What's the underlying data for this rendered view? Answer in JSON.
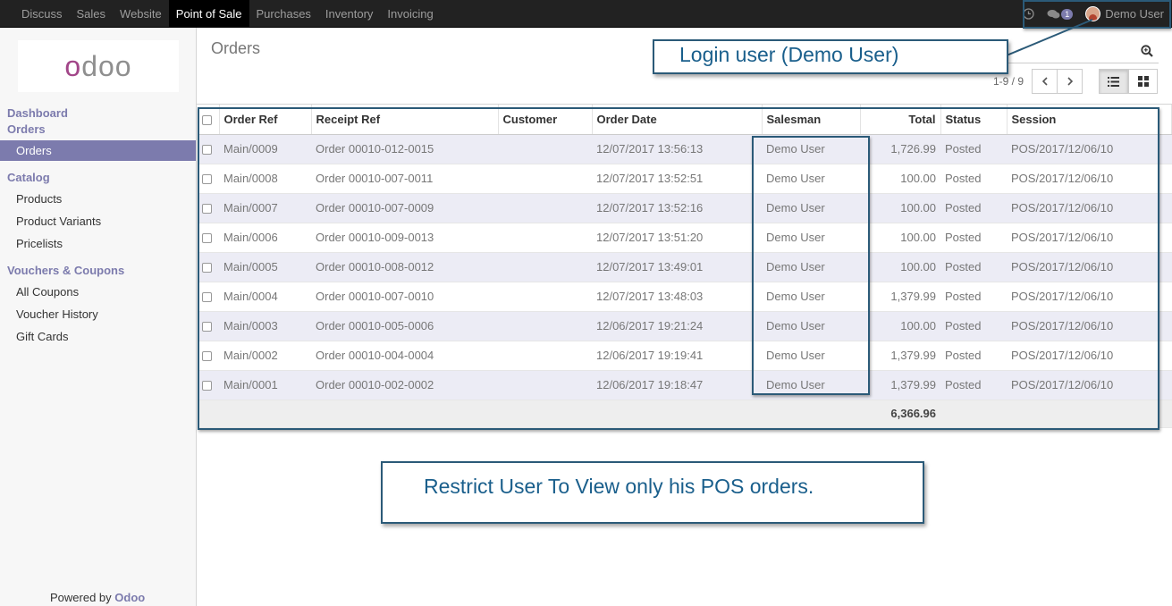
{
  "topbar": {
    "menu": [
      "Discuss",
      "Sales",
      "Website",
      "Point of Sale",
      "Purchases",
      "Inventory",
      "Invoicing"
    ],
    "active": "Point of Sale",
    "messages_badge": "1",
    "user": "Demo User"
  },
  "sidebar": {
    "logo": "odoo",
    "dashboard": "Dashboard",
    "orders_head": "Orders",
    "orders_item": "Orders",
    "catalog": "Catalog",
    "catalog_items": [
      "Products",
      "Product Variants",
      "Pricelists"
    ],
    "vouchers": "Vouchers & Coupons",
    "voucher_items": [
      "All Coupons",
      "Voucher History",
      "Gift Cards"
    ],
    "powered_prefix": "Powered by",
    "powered_brand": "Odoo"
  },
  "control": {
    "title": "Orders",
    "pager": "1-9 / 9"
  },
  "table": {
    "columns": [
      "Order Ref",
      "Receipt Ref",
      "Customer",
      "Order Date",
      "Salesman",
      "Total",
      "Status",
      "Session"
    ],
    "rows": [
      [
        "Main/0009",
        "Order 00010-012-0015",
        "",
        "12/07/2017 13:56:13",
        "Demo User",
        "1,726.99",
        "Posted",
        "POS/2017/12/06/10"
      ],
      [
        "Main/0008",
        "Order 00010-007-0011",
        "",
        "12/07/2017 13:52:51",
        "Demo User",
        "100.00",
        "Posted",
        "POS/2017/12/06/10"
      ],
      [
        "Main/0007",
        "Order 00010-007-0009",
        "",
        "12/07/2017 13:52:16",
        "Demo User",
        "100.00",
        "Posted",
        "POS/2017/12/06/10"
      ],
      [
        "Main/0006",
        "Order 00010-009-0013",
        "",
        "12/07/2017 13:51:20",
        "Demo User",
        "100.00",
        "Posted",
        "POS/2017/12/06/10"
      ],
      [
        "Main/0005",
        "Order 00010-008-0012",
        "",
        "12/07/2017 13:49:01",
        "Demo User",
        "100.00",
        "Posted",
        "POS/2017/12/06/10"
      ],
      [
        "Main/0004",
        "Order 00010-007-0010",
        "",
        "12/07/2017 13:48:03",
        "Demo User",
        "1,379.99",
        "Posted",
        "POS/2017/12/06/10"
      ],
      [
        "Main/0003",
        "Order 00010-005-0006",
        "",
        "12/06/2017 19:21:24",
        "Demo User",
        "100.00",
        "Posted",
        "POS/2017/12/06/10"
      ],
      [
        "Main/0002",
        "Order 00010-004-0004",
        "",
        "12/06/2017 19:19:41",
        "Demo User",
        "1,379.99",
        "Posted",
        "POS/2017/12/06/10"
      ],
      [
        "Main/0001",
        "Order 00010-002-0002",
        "",
        "12/06/2017 19:18:47",
        "Demo User",
        "1,379.99",
        "Posted",
        "POS/2017/12/06/10"
      ]
    ],
    "total": "6,366.96"
  },
  "annotations": {
    "login": "Login user (Demo User)",
    "restrict": "Restrict User To View only his POS orders."
  }
}
